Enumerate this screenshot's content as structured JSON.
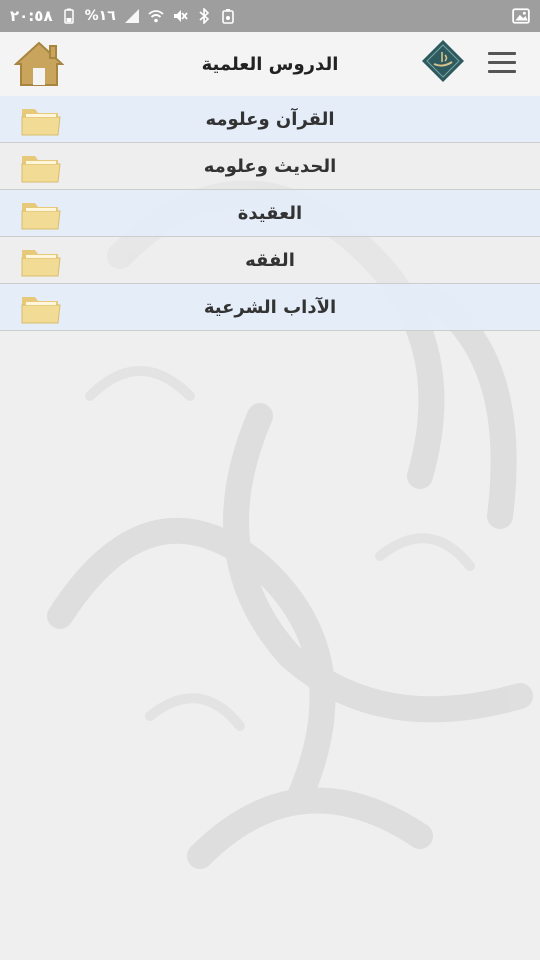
{
  "status_bar": {
    "time": "٢٠:٥٨",
    "battery_percent": "%١٦",
    "icons": [
      "battery-icon",
      "signal-icon",
      "wifi-icon",
      "mute-icon",
      "bluetooth-icon",
      "alarm-icon",
      "gallery-icon"
    ]
  },
  "header": {
    "title": "الدروس العلمية",
    "icons": [
      "home-icon",
      "logo-icon",
      "menu-icon"
    ]
  },
  "lessons": {
    "items": [
      {
        "label": "القرآن وعلومه",
        "icon": "folder-icon"
      },
      {
        "label": "الحديث وعلومه",
        "icon": "folder-icon"
      },
      {
        "label": "العقيدة",
        "icon": "folder-icon"
      },
      {
        "label": "الفقه",
        "icon": "folder-icon"
      },
      {
        "label": "الآداب الشرعية",
        "icon": "folder-icon"
      }
    ]
  },
  "colors": {
    "status_bar_bg": "#9e9e9e",
    "header_bg": "#f4f4f4",
    "row_blue": "#e4edfa",
    "folder": "#f2dc95",
    "home": "#c9a45c",
    "logo": "#2c5a5e"
  }
}
